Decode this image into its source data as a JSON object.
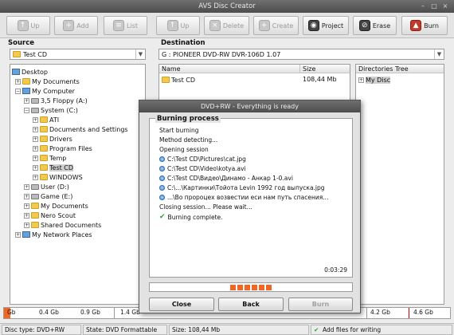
{
  "window": {
    "title": "AVS Disc Creator"
  },
  "toolbar": {
    "source_up": "Up",
    "add": "Add",
    "list": "List",
    "dest_up": "Up",
    "delete": "Delete",
    "create": "Create",
    "project": "Project",
    "erase": "Erase",
    "burn": "Burn"
  },
  "source": {
    "label": "Source",
    "combo": "Test CD",
    "tree": [
      "Desktop",
      "My Documents",
      "My Computer",
      "3,5 Floppy (A:)",
      "System (C:)",
      "ATI",
      "Documents and Settings",
      "Drivers",
      "Program Files",
      "Temp",
      "Test CD",
      "WINDOWS",
      "User (D:)",
      "Game (E:)",
      "My Documents",
      "Nero Scout",
      "Shared Documents",
      "My Network Places"
    ]
  },
  "destination": {
    "label": "Destination",
    "drive": "G : PIONEER  DVD-RW  DVR-106D 1.07",
    "col_name": "Name",
    "col_size": "Size",
    "row_name": "Test CD",
    "row_size": "108,44 Mb",
    "dirtree_header": "Directories Tree",
    "dirtree_item": "My Disc"
  },
  "dialog": {
    "title": "DVD+RW - Everything is ready",
    "heading": "Burning process",
    "lines": [
      "Start burning",
      "Method detecting...",
      "Opening session",
      "C:\\Test CD\\Pictures\\cat.jpg",
      "C:\\Test CD\\Video\\kotya.avi",
      "C:\\Test CD\\Видео\\Динамо - Анкар 1-0.avi",
      "C:\\...\\Картинки\\Тойота Levin 1992 год выпуска.jpg",
      "...\\Во пророцех возвестии еси нам путь спасения...",
      "Closing session... Please wait...",
      "Burning complete."
    ],
    "time": "0:03:29",
    "progress_fraction": 0.2,
    "close": "Close",
    "back": "Back",
    "burn": "Burn"
  },
  "ruler": {
    "ticks": [
      "Gb",
      "0.4 Gb",
      "0.9 Gb",
      "1.4 Gb",
      "4.2 Gb",
      "4.6 Gb"
    ],
    "fill_fraction": 0.015
  },
  "status": {
    "disc_type": "Disc type: DVD+RW",
    "state": "State: DVD Formattable",
    "size": "Size: 108,44 Mb",
    "hint": "Add files for writing"
  },
  "colors": {
    "accent": "#f26522",
    "ok": "#2aa52a"
  }
}
